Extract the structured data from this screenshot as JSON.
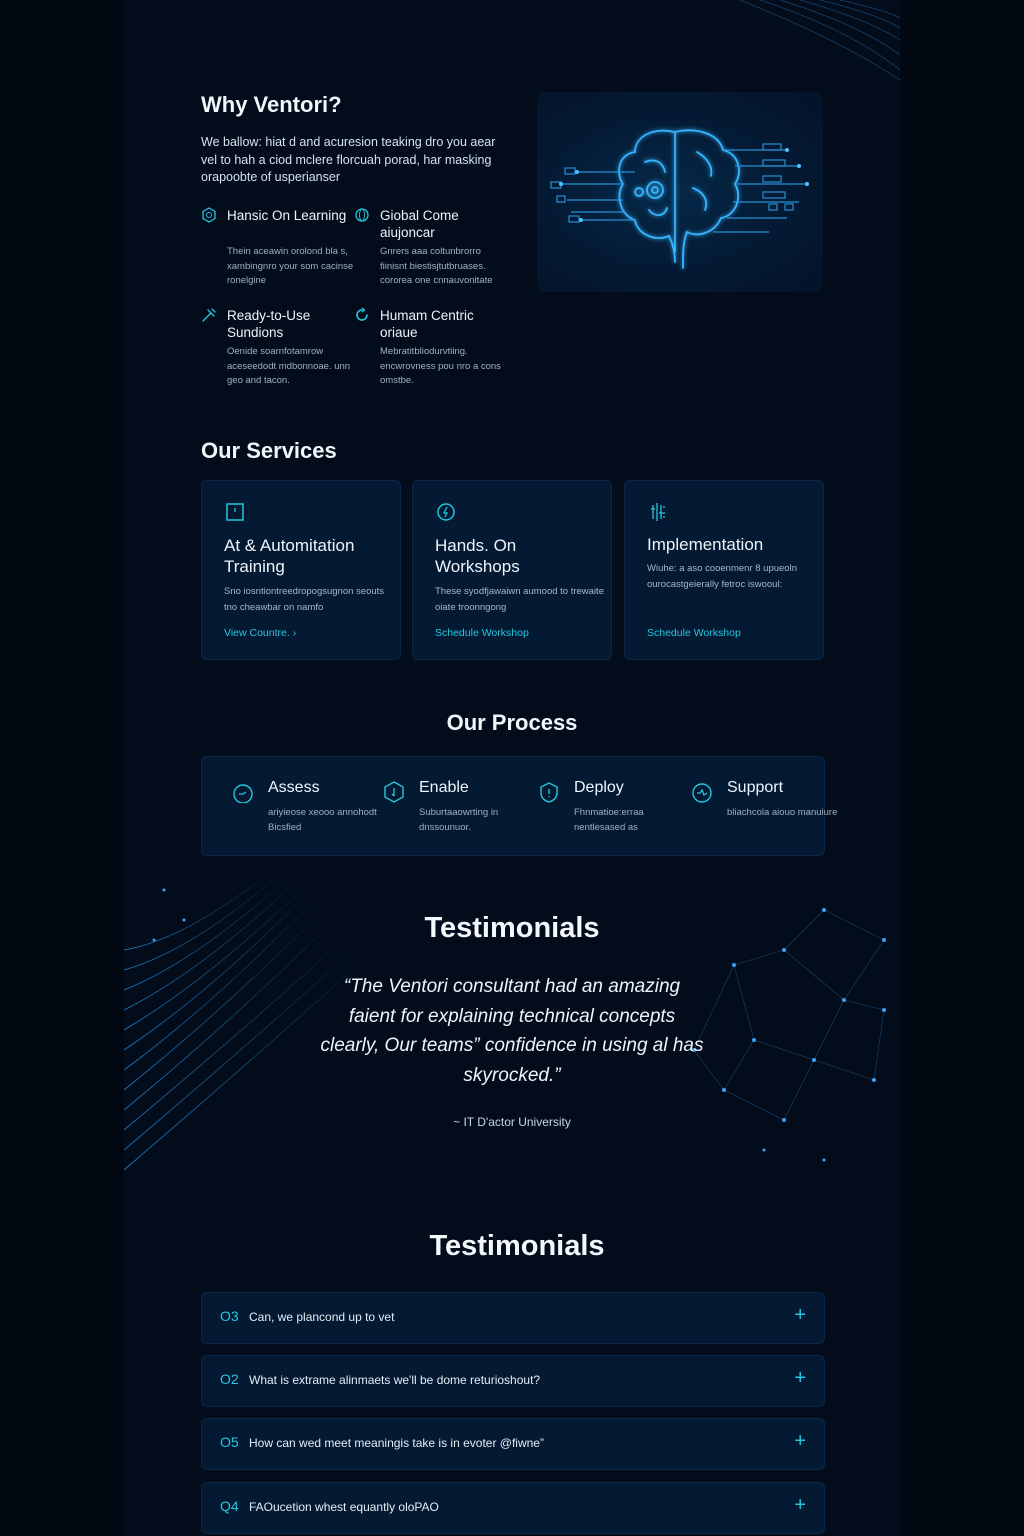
{
  "why": {
    "title": "Why Ventori?",
    "intro": "We ballow: hiat d and acuresion teaking dro you aear vel to hah a ciod mclere florcuah porad, har masking orapoobte of usperianser",
    "features": [
      {
        "icon": "brain-hex-icon",
        "title": "Hansic On Learning",
        "desc": "Thein aceawin orolond bla s, xambingnro your som cacinse ronelgine"
      },
      {
        "icon": "globe-icon",
        "title": "Giobal Come aiujoncar",
        "desc": "Gnrers aaa coltunbrorro fiinisnt biestisjtutbruases. cororea one cnnauvonitate"
      },
      {
        "icon": "tools-icon",
        "title": "Ready-to-Use Sundions",
        "desc": "Oenide soarnfotamrow aceseedodt mdbonnoae. unn geo and tacon."
      },
      {
        "icon": "human-cycle-icon",
        "title": "Humam Centric oriaue",
        "desc": "Mebratitbliodurvtiing. encwrovness pou nro a cons omstbe."
      }
    ]
  },
  "services": {
    "title": "Our Services",
    "cards": [
      {
        "icon": "square-icon",
        "title": "At & Automitation Training",
        "desc": "Sno iosntiontreedropogsugnon seouts tno cheawbar on namfo",
        "link": "View Countre.",
        "link_arrow": "›"
      },
      {
        "icon": "bulb-icon",
        "title": "Hands. On Workshops",
        "desc": "These syodfjawaiwn aumood to trewaite oiate troonngong",
        "link": "Schedule Workshop",
        "link_arrow": ""
      },
      {
        "icon": "circuit-icon",
        "title": "Implementation",
        "desc": "Wiuhe: a aso cooenmenr 8 upueoln ourocastgeierally fetroc iswooul:",
        "link": "Schedule Workshop",
        "link_arrow": ""
      }
    ]
  },
  "process": {
    "title": "Our Process",
    "steps": [
      {
        "icon": "gauge-icon",
        "title": "Assess",
        "desc": "ariyieose xeooo annohodt Bicsfied"
      },
      {
        "icon": "hex-key-icon",
        "title": "Enable",
        "desc": "Suburtaaowrting in dnssounuor."
      },
      {
        "icon": "shield-icon",
        "title": "Deploy",
        "desc": "Fhnmatioe:erraa nentlesased as"
      },
      {
        "icon": "support-icon",
        "title": "Support",
        "desc": "bliachcola aiouo manuiure"
      }
    ]
  },
  "testimonials": {
    "title": "Testimonials",
    "quote": "“The Ventori consultant had an amazing faient for explaining technical concepts clearly, Our teams” confidence in using al has skyrocked.”",
    "attribution": "~ IT D'actor University"
  },
  "faq": {
    "title": "Testimonials",
    "plus": "+",
    "items": [
      {
        "num": "O3",
        "q": "Can, we plancond up to vet"
      },
      {
        "num": "O2",
        "q": "What is extrame alinmaets we'll be dome returioshout?"
      },
      {
        "num": "O5",
        "q": "How can wed meet meaningis take is in evoter @fiwne”"
      },
      {
        "num": "Q4",
        "q": "FAOucetion whest equantly oloPAO"
      }
    ]
  },
  "colors": {
    "background": "#020c1b",
    "card": "#041a33",
    "accent": "#26c6e0"
  }
}
